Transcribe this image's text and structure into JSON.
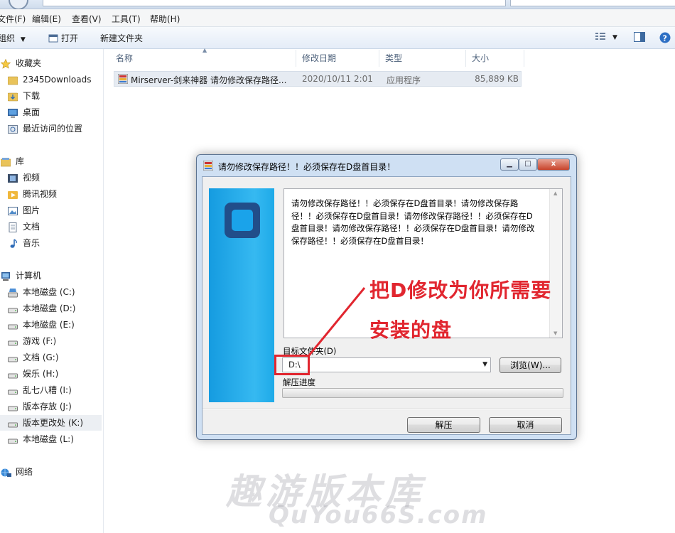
{
  "menu": [
    "文件(F)",
    "编辑(E)",
    "查看(V)",
    "工具(T)",
    "帮助(H)"
  ],
  "command_bar": {
    "organize": "组织",
    "open": "打开",
    "new_folder": "新建文件夹"
  },
  "nav": {
    "favorites": {
      "header": "收藏夹",
      "items": [
        "2345Downloads",
        "下载",
        "桌面",
        "最近访问的位置"
      ]
    },
    "libraries": {
      "header": "库",
      "items": [
        "视频",
        "腾讯视频",
        "图片",
        "文档",
        "音乐"
      ]
    },
    "computer": {
      "header": "计算机",
      "items": [
        "本地磁盘 (C:)",
        "本地磁盘 (D:)",
        "本地磁盘 (E:)",
        "游戏 (F:)",
        "文档 (G:)",
        "娱乐 (H:)",
        "乱七八糟 (I:)",
        "版本存放 (J:)",
        "版本更改处 (K:)",
        "本地磁盘 (L:)"
      ],
      "selected": "版本更改处 (K:)"
    },
    "network": {
      "header": "网络"
    }
  },
  "columns": [
    "名称",
    "修改日期",
    "类型",
    "大小"
  ],
  "files": [
    {
      "name": "Mirserver-剑来神器 请勿修改保存路径...",
      "date": "2020/10/11 2:01",
      "type": "应用程序",
      "size": "85,889 KB"
    }
  ],
  "dialog": {
    "title": "请勿修改保存路径！！必须保存在D盘首目录！",
    "message": "请勿修改保存路径！！必须保存在D盘首目录！请勿修改保存路径！！必须保存在D盘首目录！请勿修改保存路径！！必须保存在D盘首目录！请勿修改保存路径！！必须保存在D盘首目录！请勿修改保存路径！！必须保存在D盘首目录！",
    "target_label": "目标文件夹(D)",
    "target_value": "D:\\",
    "browse_button": "浏览(W)...",
    "progress_label": "解压进度",
    "progress": 0,
    "extract_button": "解压",
    "cancel_button": "取消",
    "close_glyph": "x"
  },
  "annotation": {
    "line1": "把D修改为你所需要",
    "line2": "安装的盘",
    "color": "#e1262f"
  },
  "watermark": {
    "chinese": "趣游版本库",
    "english": "QuYou66S.com"
  }
}
